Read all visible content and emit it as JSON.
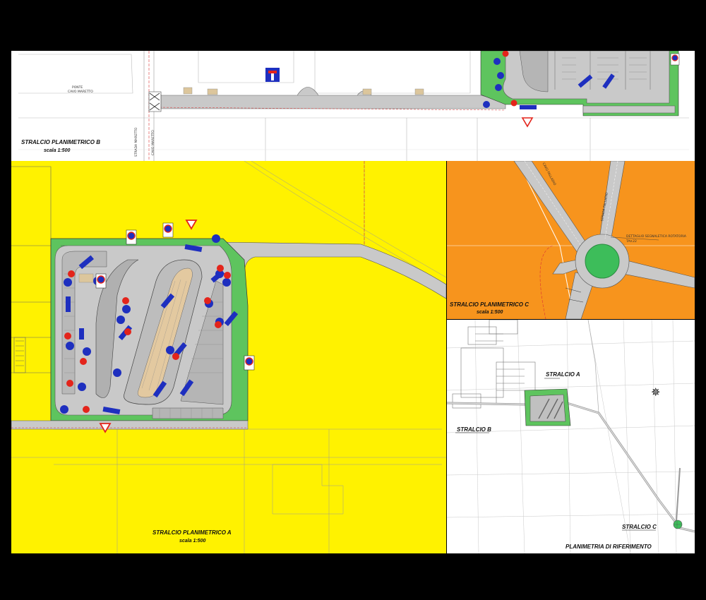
{
  "panels": {
    "stralcio_b": {
      "title": "STRALCIO PLANIMETRICO B",
      "scale": "scala 1:500",
      "ponte_label_1": "PONTE",
      "ponte_label_2": "CAVO MARETTO",
      "strada_label": "STRADA MARETTO",
      "cavo_label": "CAVO MARETTO"
    },
    "stralcio_a": {
      "title": "STRALCIO PLANIMETRICO A",
      "scale": "scala 1:500"
    },
    "stralcio_c": {
      "title": "STRALCIO PLANIMETRICO C",
      "scale": "scala 1:500",
      "cavo_label": "CAVO FALLADIO",
      "strada_label": "STRADA FALLADIO",
      "detail_label_1": "DETTAGLIO SEGNALETICA ROTATORIA",
      "detail_label_2": "TAV.22"
    },
    "riferimento": {
      "title": "PLANIMETRIA DI RIFERIMENTO",
      "label_a": "STRALCIO A",
      "label_b": "STRALCIO B",
      "label_c": "STRALCIO C"
    }
  },
  "colors": {
    "background": "#000000",
    "sheet": "#ffffff",
    "zone_a": "#fff200",
    "zone_c": "#f7941d",
    "green": "#5ec45e",
    "road": "#c8c8c8",
    "sign_blue": "#1e2fbf",
    "sign_red": "#e3241b"
  },
  "icons": {
    "compass": "north-arrow-icon",
    "dead_end": "dead-end-sign-icon",
    "give_way": "give-way-sign-icon"
  }
}
